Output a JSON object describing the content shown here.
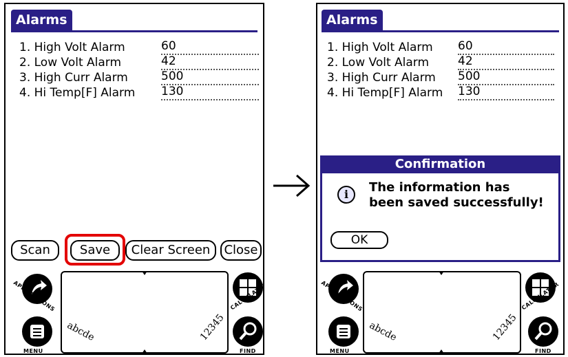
{
  "left_screen": {
    "title": "Alarms",
    "alarms": [
      {
        "label": "1. High Volt Alarm",
        "value": "60"
      },
      {
        "label": "2. Low Volt Alarm",
        "value": "42"
      },
      {
        "label": "3. High Curr Alarm",
        "value": "500"
      },
      {
        "label": "4. Hi Temp[F] Alarm",
        "value": "130"
      }
    ],
    "buttons": {
      "scan": "Scan",
      "save": "Save",
      "clear": "Clear Screen",
      "close": "Close"
    }
  },
  "right_screen": {
    "title": "Alarms",
    "alarms": [
      {
        "label": "1. High Volt Alarm",
        "value": "60"
      },
      {
        "label": "2. Low Volt Alarm",
        "value": "42"
      },
      {
        "label": "3. High Curr Alarm",
        "value": "500"
      },
      {
        "label": "4. Hi Temp[F] Alarm",
        "value": "130"
      }
    ],
    "dialog": {
      "title": "Confirmation",
      "message_line1": "The information has",
      "message_line2": "been saved successfully!",
      "ok": "OK"
    }
  },
  "silkscreen": {
    "applications": "APPLICATIONS",
    "menu": "MENU",
    "calculator": "CALCULATOR",
    "find": "FIND",
    "letters": "abcde",
    "numbers": "12345"
  },
  "colors": {
    "title_bar": "#2a1f86",
    "highlight": "#e30000"
  },
  "icons": [
    "applications-icon",
    "menu-icon",
    "calculator-icon",
    "find-icon",
    "info-icon",
    "right-arrow-icon"
  ]
}
